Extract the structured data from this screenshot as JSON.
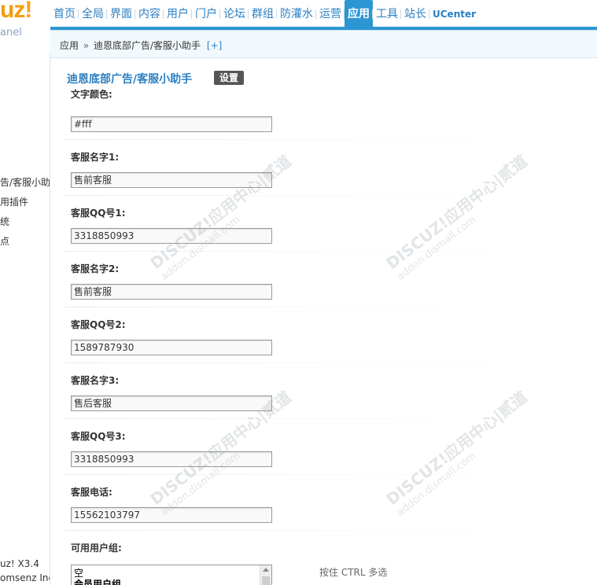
{
  "logo": {
    "text": "uz",
    "bang": "!",
    "subtitle": "anel"
  },
  "nav": {
    "items": [
      "首页",
      "全局",
      "界面",
      "内容",
      "用户",
      "门户",
      "论坛",
      "群组",
      "防灌水",
      "运营",
      "应用",
      "工具",
      "站长"
    ],
    "active": "应用",
    "ucenter": "UCenter"
  },
  "breadcrumb": {
    "root": "应用",
    "sep": "»",
    "current": "迪恩底部广告/客服小助手",
    "add": "[+]"
  },
  "left_menu": [
    "告/客服小助",
    "用插件",
    "统",
    "点"
  ],
  "left_footer": [
    "uz! X3.4",
    "omsenz Inc."
  ],
  "page": {
    "title": "迪恩底部广告/客服小助手",
    "tab_settings": "设置"
  },
  "fields": [
    {
      "label": "文字颜色:",
      "value": "#fff"
    },
    {
      "label": "客服名字1:",
      "value": "售前客服"
    },
    {
      "label": "客服QQ号1:",
      "value": "3318850993"
    },
    {
      "label": "客服名字2:",
      "value": "售前客服"
    },
    {
      "label": "客服QQ号2:",
      "value": "1589787930"
    },
    {
      "label": "客服名字3:",
      "value": "售后客服"
    },
    {
      "label": "客服QQ号3:",
      "value": "3318850993"
    },
    {
      "label": "客服电话:",
      "value": "15562103797"
    }
  ],
  "usergroups": {
    "label": "可用用户组:",
    "options": [
      "空",
      "会员用户组"
    ],
    "hint": "按住 CTRL 多选"
  },
  "watermark": {
    "brand": "DISCUZ!应用中心|贰道",
    "url": "addon.dismall.com"
  }
}
